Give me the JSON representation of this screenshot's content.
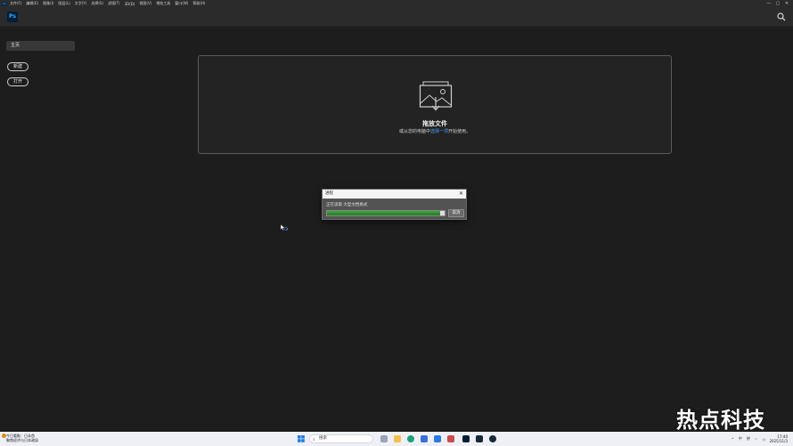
{
  "menubar": {
    "app_abbr": "Ps",
    "items": [
      "文件(F)",
      "编辑(E)",
      "图像(I)",
      "图层(L)",
      "文字(Y)",
      "选择(S)",
      "滤镜(T)",
      "3D(D)",
      "视图(V)",
      "增效工具",
      "窗口(W)",
      "帮助(H)"
    ],
    "controls": [
      "—",
      "▢",
      "✕"
    ]
  },
  "header": {
    "logo": "Ps",
    "search_icon": "search-icon"
  },
  "sidebar": {
    "home": "主页",
    "new_label": "新建",
    "open_label": "打开"
  },
  "dropzone": {
    "title": "拖放文件",
    "subtitle_pre": "或从您的电脑中",
    "subtitle_link": "选择一项",
    "subtitle_post": "开始使用。",
    "icon": "image-upload-icon"
  },
  "progress_dialog": {
    "title": "进程",
    "status": "正在读取 大型文档格式",
    "cancel_label": "取消",
    "progress": 0.96,
    "fill_color": "#2e9a2e"
  },
  "watermark": "热点科技",
  "taskbar": {
    "news_line1": "今日看點：日本首",
    "news_line2": "聚焦经济与日本政局",
    "search_placeholder": "搜索",
    "tray_ime": "中",
    "tray_lang": "拼",
    "time": "17:40",
    "date": "2025/11/3"
  }
}
